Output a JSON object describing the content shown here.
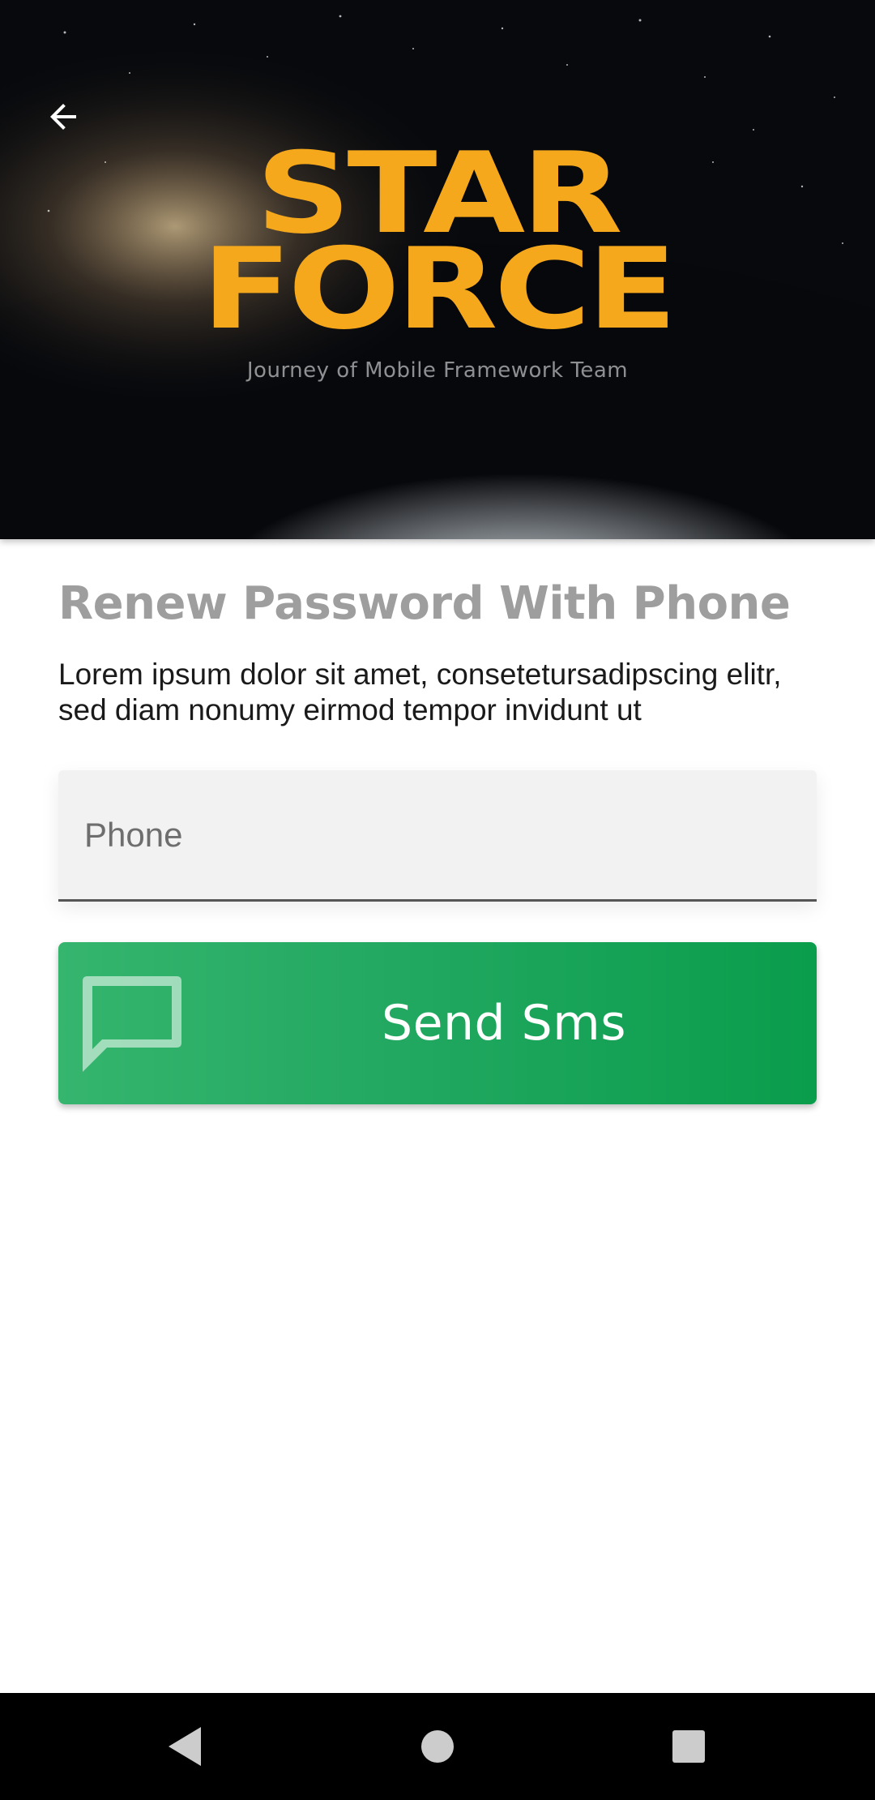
{
  "header": {
    "logo_line1": "STAR",
    "logo_line2": "FORCE",
    "logo_tagline": "Journey of Mobile Framework Team",
    "back_icon": "arrow-left-icon",
    "colors": {
      "logo": "#f6a81c",
      "space": "#0a0d14",
      "earth": "#5f8fb0"
    }
  },
  "content": {
    "title": "Renew Password With Phone",
    "description": "Lorem ipsum dolor sit amet, consetetursadipscing elitr, sed diam nonumy eirmod tempor invidunt ut"
  },
  "phone_field": {
    "placeholder": "Phone",
    "value": ""
  },
  "sms_button": {
    "label": "Send Sms",
    "icon": "message-icon",
    "colors": {
      "gradient_start": "#35b56e",
      "gradient_end": "#0a9d4c"
    }
  },
  "nav_bar": {
    "back_icon": "nav-back-icon",
    "home_icon": "nav-home-icon",
    "recents_icon": "nav-recents-icon"
  }
}
